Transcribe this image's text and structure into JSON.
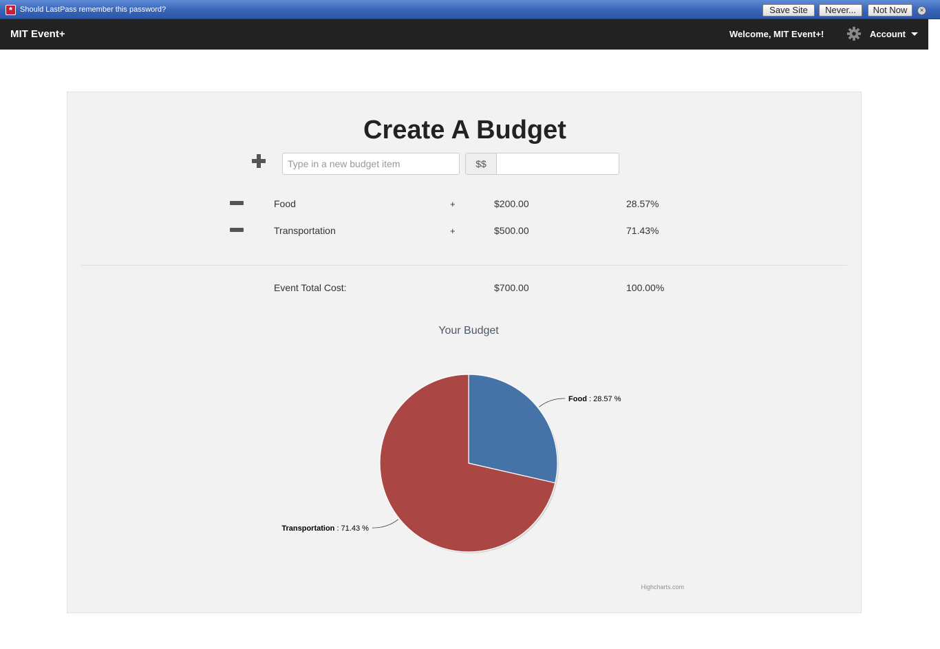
{
  "lastpass": {
    "logo_glyph": "*",
    "prompt": "Should LastPass remember this password?",
    "save_site": "Save Site",
    "never": "Never...",
    "not_now": "Not Now",
    "close_glyph": "×"
  },
  "navbar": {
    "brand": "MIT Event+",
    "welcome": "Welcome, MIT Event+!",
    "account": "Account"
  },
  "page": {
    "title": "Create A Budget",
    "new_item_placeholder": "Type in a new budget item",
    "currency_addon": "$$",
    "amount_value": ""
  },
  "budget_items": [
    {
      "name": "Food",
      "plus": "+",
      "amount": "$200.00",
      "percent": "28.57%"
    },
    {
      "name": "Transportation",
      "plus": "+",
      "amount": "$500.00",
      "percent": "71.43%"
    }
  ],
  "total": {
    "label": "Event Total Cost:",
    "amount": "$700.00",
    "percent": "100.00%"
  },
  "colors": {
    "food": "#4572a7",
    "transportation": "#aa4643",
    "navbar": "#222222",
    "panel": "#f2f2f2"
  },
  "chart_data": {
    "type": "pie",
    "title": "Your Budget",
    "slices": [
      {
        "name": "Food",
        "value": 28.57,
        "label_suffix": " : 28.57 %",
        "color": "#4572a7"
      },
      {
        "name": "Transportation",
        "value": 71.43,
        "label_suffix": " : 71.43 %",
        "color": "#aa4643"
      }
    ],
    "credits": "Highcharts.com"
  }
}
